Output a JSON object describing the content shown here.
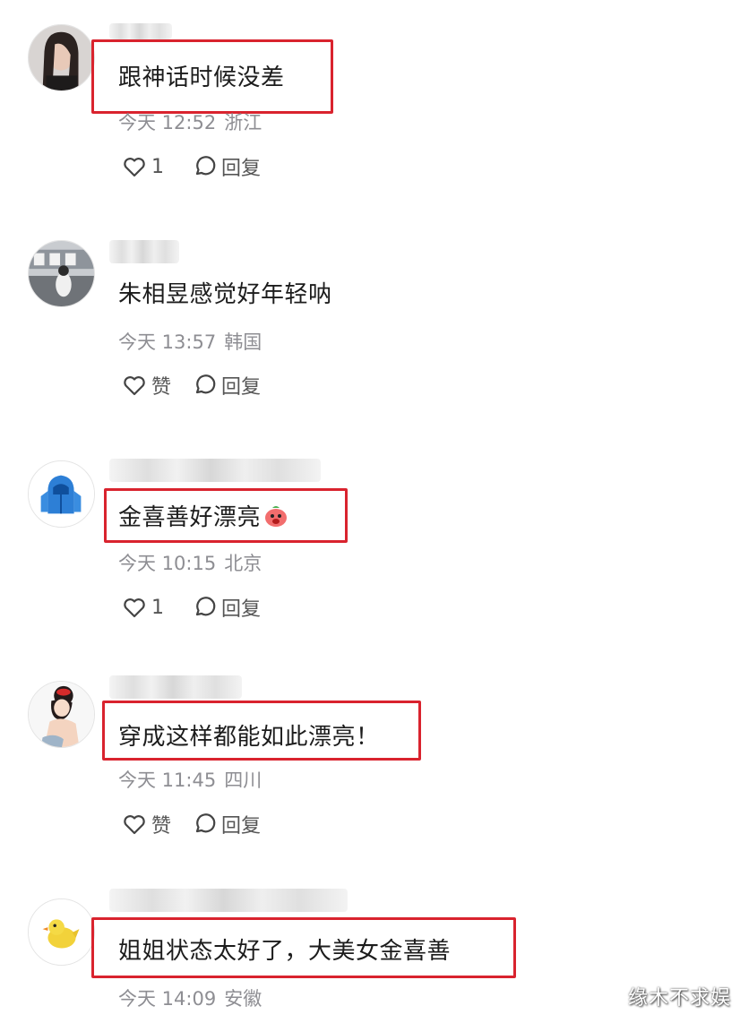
{
  "comments": [
    {
      "text": "跟神话时候没差",
      "time": "今天 12:52",
      "region": "浙江",
      "like_label": "1",
      "reply_label": "回复"
    },
    {
      "text": "朱相昱感觉好年轻呐",
      "time": "今天 13:57",
      "region": "韩国",
      "like_label": "赞",
      "reply_label": "回复"
    },
    {
      "text": "金喜善好漂亮",
      "time": "今天 10:15",
      "region": "北京",
      "like_label": "1",
      "reply_label": "回复",
      "emoji": "red-face-emoji"
    },
    {
      "text": "穿成这样都能如此漂亮！",
      "time": "今天 11:45",
      "region": "四川",
      "like_label": "赞",
      "reply_label": "回复"
    },
    {
      "text": "姐姐状态太好了，大美女金喜善",
      "time": "今天 14:09",
      "region": "安徽"
    }
  ],
  "watermark": "缘木不求娱",
  "colors": {
    "highlight": "#d9232e",
    "meta": "#8e8e93",
    "text": "#1c1c1c"
  },
  "icons": {
    "like": "heart-icon",
    "reply": "speech-bubble-icon"
  }
}
